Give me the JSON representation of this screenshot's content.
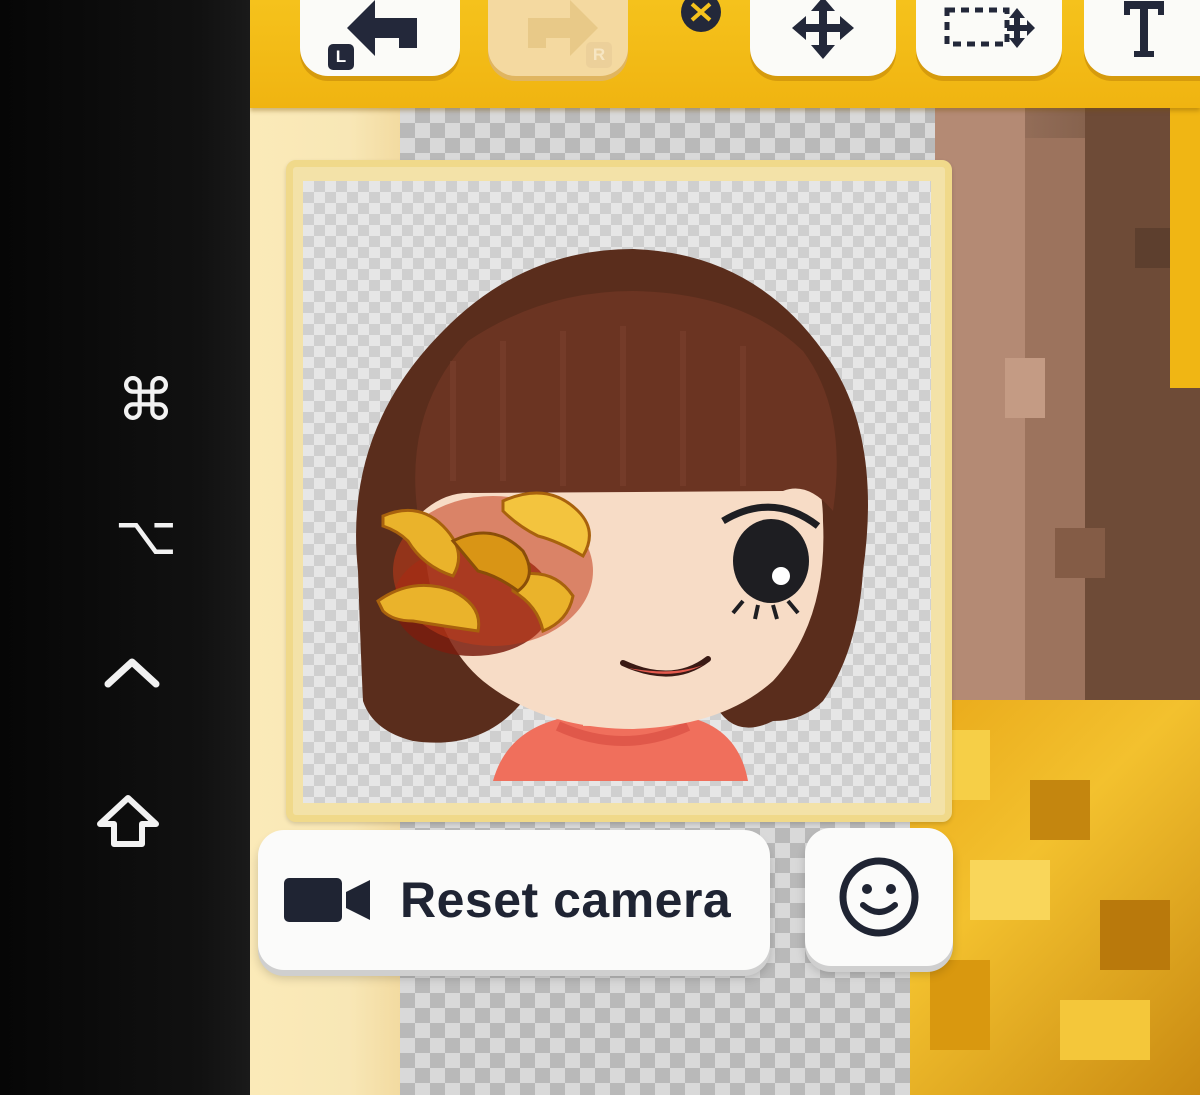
{
  "system_bar": {
    "modifier_keys": [
      {
        "name": "command-key-icon",
        "glyph": "⌘"
      },
      {
        "name": "option-key-icon",
        "glyph": "⌥"
      },
      {
        "name": "control-key-icon",
        "glyph": "^"
      },
      {
        "name": "shift-key-icon",
        "glyph": "⇧"
      }
    ]
  },
  "toolbar": {
    "undo_badge": "L",
    "redo_badge": "R"
  },
  "preview": {
    "reset_camera_label": "Reset camera"
  },
  "colors": {
    "toolbar": "#f0b411",
    "button_text": "#1f2433",
    "hair": "#5a2d1c",
    "skin": "#f7dcc6",
    "shirt": "#f06f5c",
    "flame": "#e8a01a"
  }
}
